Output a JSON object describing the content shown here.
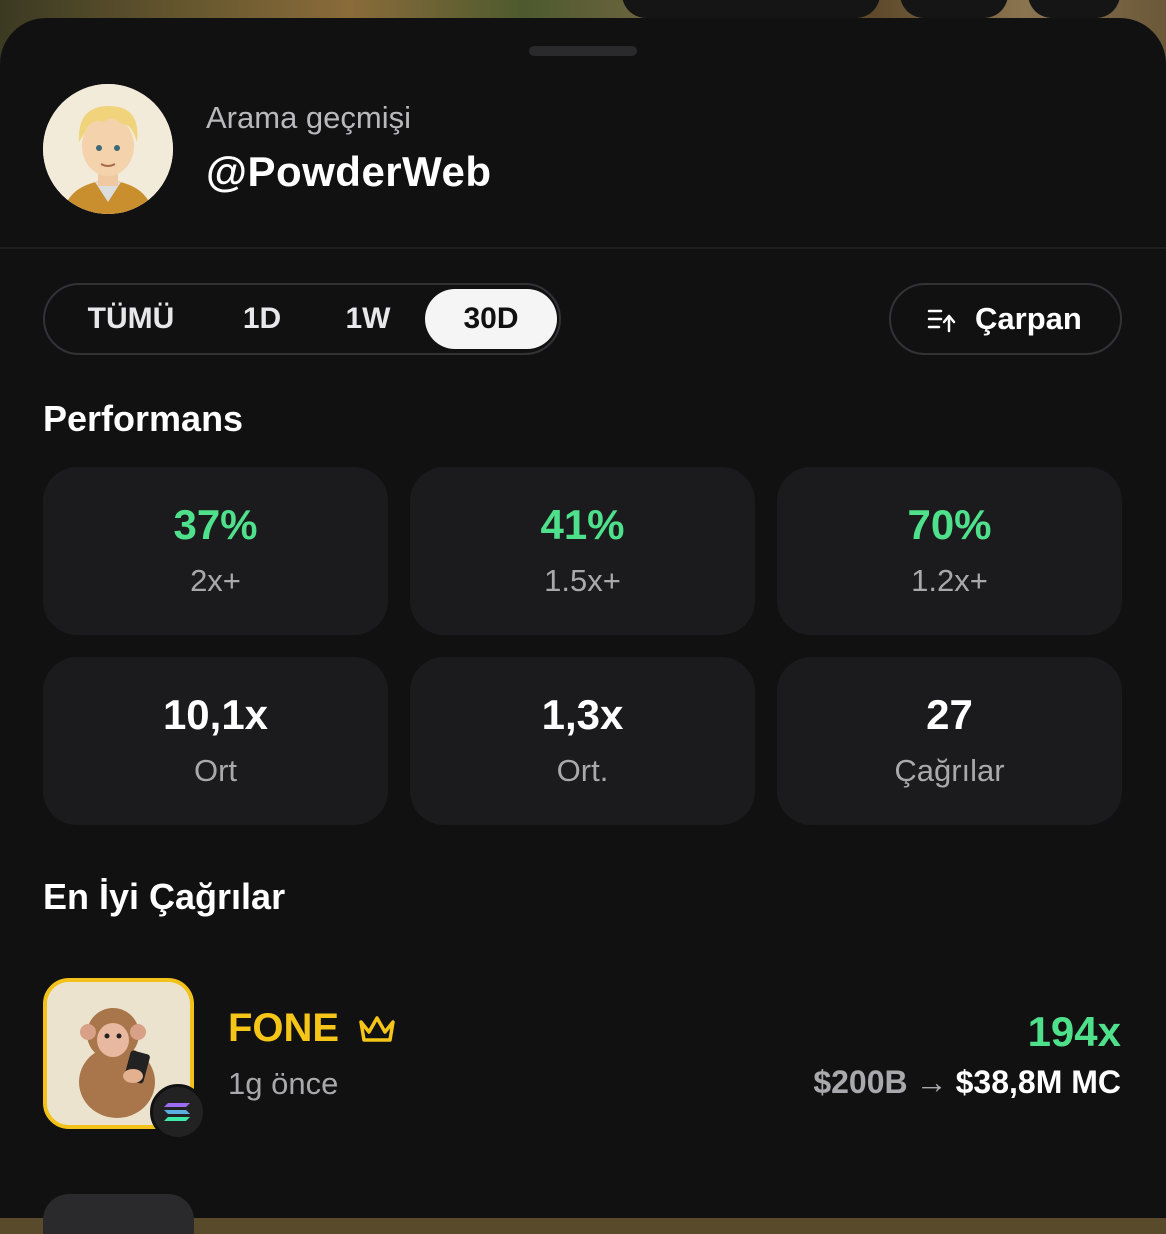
{
  "header": {
    "subtitle": "Arama geçmişi",
    "username": "@PowderWeb"
  },
  "tabs": [
    {
      "label": "TÜMÜ",
      "active": false
    },
    {
      "label": "1D",
      "active": false
    },
    {
      "label": "1W",
      "active": false
    },
    {
      "label": "30D",
      "active": true
    }
  ],
  "sort_button": {
    "label": "Çarpan",
    "icon": "sort-icon"
  },
  "performance": {
    "title": "Performans",
    "cards": [
      {
        "value": "37%",
        "caption": "2x+",
        "highlight": true
      },
      {
        "value": "41%",
        "caption": "1.5x+",
        "highlight": true
      },
      {
        "value": "70%",
        "caption": "1.2x+",
        "highlight": true
      },
      {
        "value": "10,1x",
        "caption": "Ort",
        "highlight": false
      },
      {
        "value": "1,3x",
        "caption": "Ort.",
        "highlight": false
      },
      {
        "value": "27",
        "caption": "Çağrılar",
        "highlight": false
      }
    ]
  },
  "best_calls": {
    "title": "En İyi Çağrılar",
    "items": [
      {
        "name": "FONE",
        "badge_icon": "crown-icon",
        "time": "1g önce",
        "multiplier": "194x",
        "mc_from": "$200B",
        "mc_to": "$38,8M",
        "mc_suffix": "MC",
        "chain_icon": "solana-icon"
      }
    ]
  },
  "colors": {
    "background": "#111112",
    "card": "#1b1b1d",
    "positive": "#4fe08c",
    "token_accent": "#f5c518"
  }
}
